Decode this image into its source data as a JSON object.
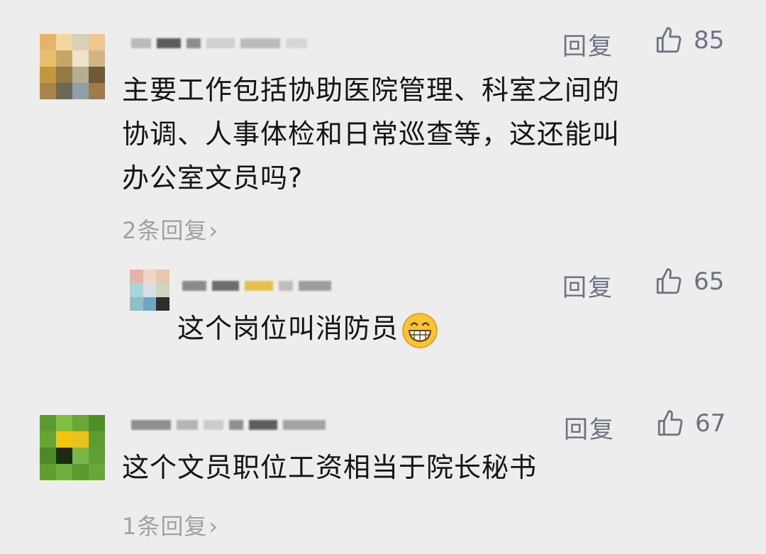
{
  "comments": [
    {
      "text_lines": [
        "主要工作包括协助医院管理、科室之间的",
        "协调、人事体检和日常巡查等，这还能叫",
        "办公室文员吗?"
      ],
      "reply_label": "回复",
      "likes": "85",
      "more_replies": "2条回复",
      "reply": {
        "text": "这个岗位叫消防员",
        "reply_label": "回复",
        "likes": "65",
        "emoji": "grinning-face-emoji"
      }
    },
    {
      "text_lines": [
        "这个文员职位工资相当于院长秘书"
      ],
      "reply_label": "回复",
      "likes": "67",
      "more_replies": "1条回复"
    }
  ],
  "colors": {
    "background": "#ededed",
    "meta_text": "#6b7383",
    "muted_text": "#a1a1a1",
    "body_text": "#141414"
  },
  "icons": {
    "like": "thumbs-up-icon",
    "chevron": "chevron-right-icon"
  }
}
